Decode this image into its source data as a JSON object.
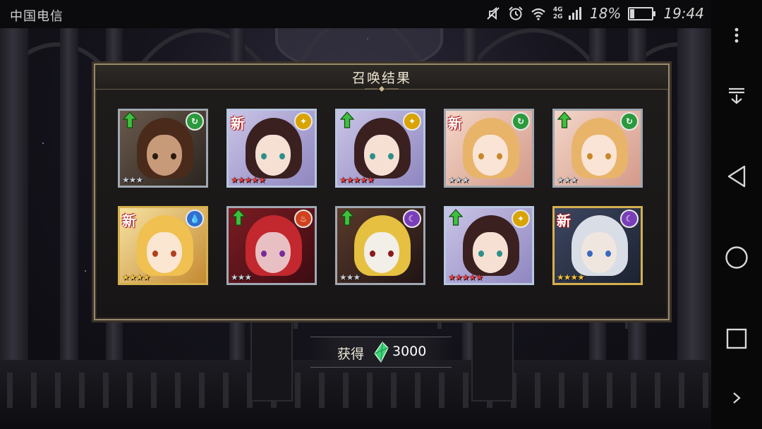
{
  "status_bar": {
    "carrier": "中国电信",
    "network": "4G 2G",
    "battery": "18%",
    "battery_level": 0.18,
    "time": "19:44",
    "icons": [
      "mute-icon",
      "alarm-icon",
      "wifi-icon",
      "signal-icon",
      "battery-icon"
    ]
  },
  "dialog": {
    "title": "召唤结果",
    "cards": [
      {
        "badge": "up",
        "element": "wind",
        "frame": "silver",
        "stars": 3,
        "rank_color": "silver",
        "character": "bearded-man"
      },
      {
        "badge": "new",
        "new_text": "新",
        "element": "light",
        "frame": "rainbow",
        "stars": 5,
        "rank_color": "red",
        "character": "brown-hair-girl"
      },
      {
        "badge": "up",
        "element": "light",
        "frame": "rainbow",
        "stars": 5,
        "rank_color": "red",
        "character": "brown-hair-girl"
      },
      {
        "badge": "new",
        "new_text": "新",
        "element": "wind",
        "frame": "silver",
        "stars": 3,
        "rank_color": "silver",
        "character": "flower-girl"
      },
      {
        "badge": "up",
        "element": "wind",
        "frame": "silver",
        "stars": 3,
        "rank_color": "silver",
        "character": "flower-girl"
      },
      {
        "badge": "new",
        "new_text": "新",
        "element": "water",
        "frame": "gold",
        "stars": 4,
        "rank_color": "gold",
        "character": "blonde-girl"
      },
      {
        "badge": "up",
        "element": "fire",
        "frame": "silver",
        "stars": 3,
        "rank_color": "silver",
        "character": "red-hair-elf"
      },
      {
        "badge": "up",
        "element": "dark",
        "frame": "silver",
        "stars": 3,
        "rank_color": "silver",
        "character": "masked-doll"
      },
      {
        "badge": "up",
        "element": "light",
        "frame": "rainbow",
        "stars": 5,
        "rank_color": "red",
        "character": "brown-hair-girl"
      },
      {
        "badge": "new",
        "new_text": "新",
        "element": "dark",
        "frame": "gold",
        "stars": 4,
        "rank_color": "gold",
        "character": "silver-hair-boy"
      }
    ]
  },
  "reward": {
    "label": "获得",
    "icon": "green-crystal-icon",
    "value": "3000"
  },
  "nav_bar": {
    "buttons": [
      "more-icon",
      "notification-pull-icon",
      "back-icon",
      "home-icon",
      "recents-icon",
      "expand-icon"
    ]
  },
  "colors": {
    "silver_frame": "#a0a7b2",
    "gold_frame": "#d6b04e",
    "up_arrow": "#3fbf3f",
    "new_badge": "#b01818",
    "element_wind": "#2a9a3c",
    "element_light": "#d9a300",
    "element_water": "#2f6fd0",
    "element_fire": "#d2401c",
    "element_dark": "#7a3fb8"
  }
}
